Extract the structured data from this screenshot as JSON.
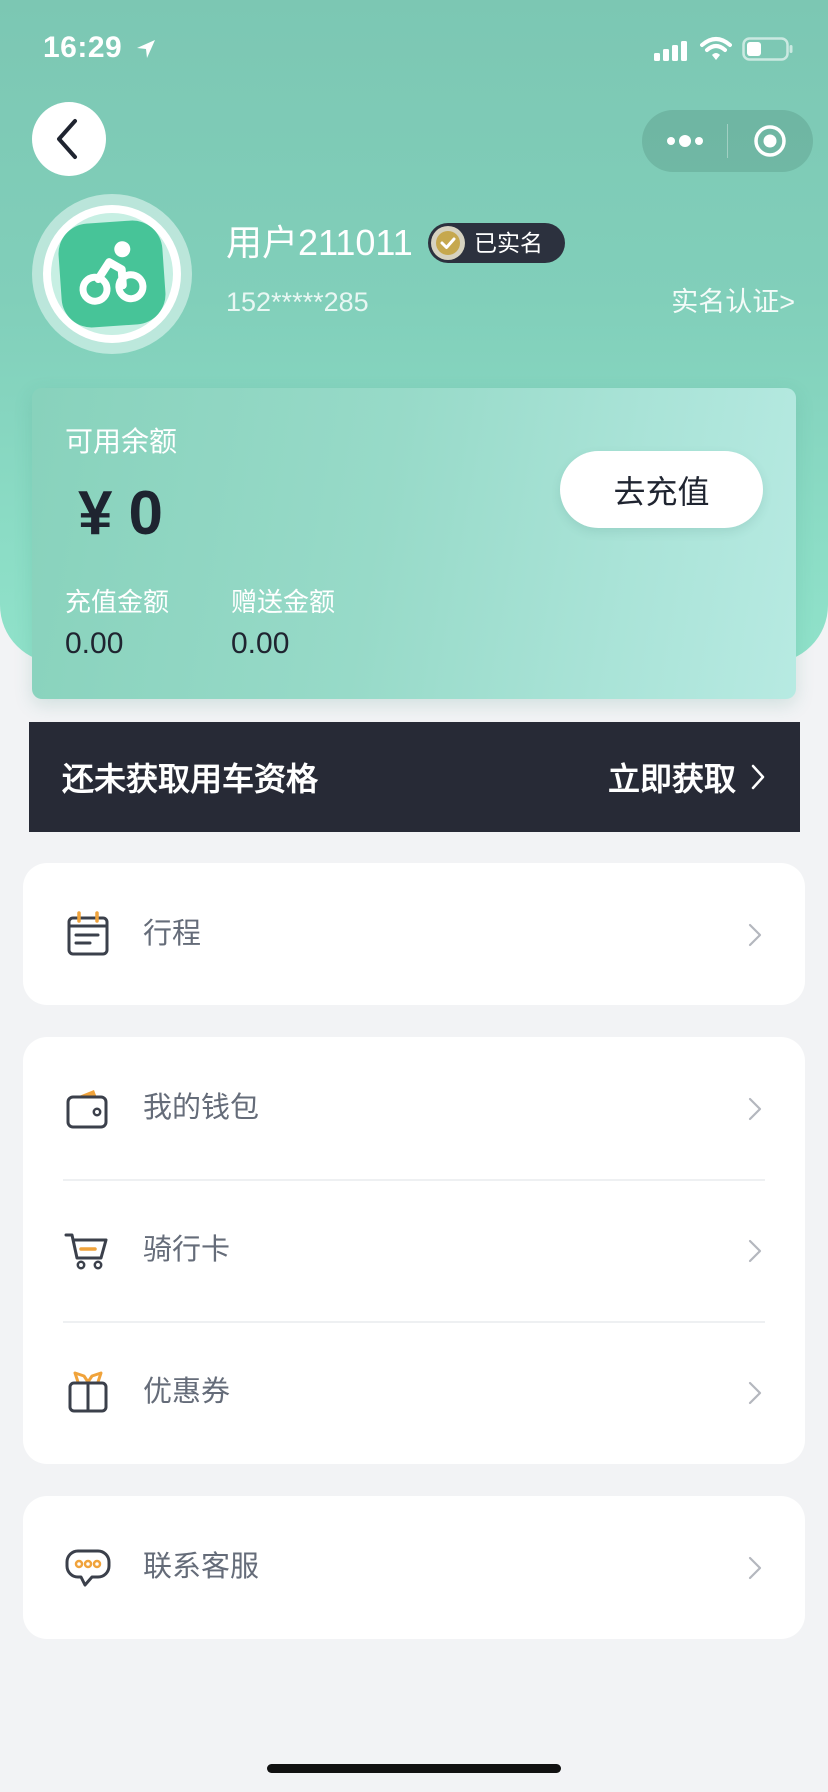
{
  "status_bar": {
    "time": "16:29"
  },
  "nav": {
    "back_icon": "chevron-left-icon",
    "more_icon": "more-dots-icon",
    "close_icon": "target-circle-icon"
  },
  "profile": {
    "avatar_icon": "cyclist-icon",
    "username": "用户211011",
    "verified_badge": "已实名",
    "phone": "152*****285",
    "verify_link": "实名认证>"
  },
  "balance": {
    "title": "可用余额",
    "currency": "¥",
    "amount": "0",
    "recharge_button": "去充值",
    "recharge_label": "充值金额",
    "recharge_value": "0.00",
    "bonus_label": "赠送金额",
    "bonus_value": "0.00"
  },
  "qualification": {
    "message": "还未获取用车资格",
    "action": "立即获取"
  },
  "menu": {
    "trip": {
      "label": "行程",
      "icon": "journal-icon"
    },
    "wallet": {
      "label": "我的钱包",
      "icon": "wallet-icon"
    },
    "riding_card": {
      "label": "骑行卡",
      "icon": "cart-icon"
    },
    "coupons": {
      "label": "优惠券",
      "icon": "gift-icon"
    },
    "support": {
      "label": "联系客服",
      "icon": "chat-bubble-icon"
    }
  },
  "colors": {
    "header_top": "#7cc7b3",
    "header_bottom": "#90e2ca",
    "avatar_green": "#47c498",
    "accent_orange": "#f0a33b",
    "dark_bar": "#272a36",
    "page_bg": "#f2f3f5"
  }
}
